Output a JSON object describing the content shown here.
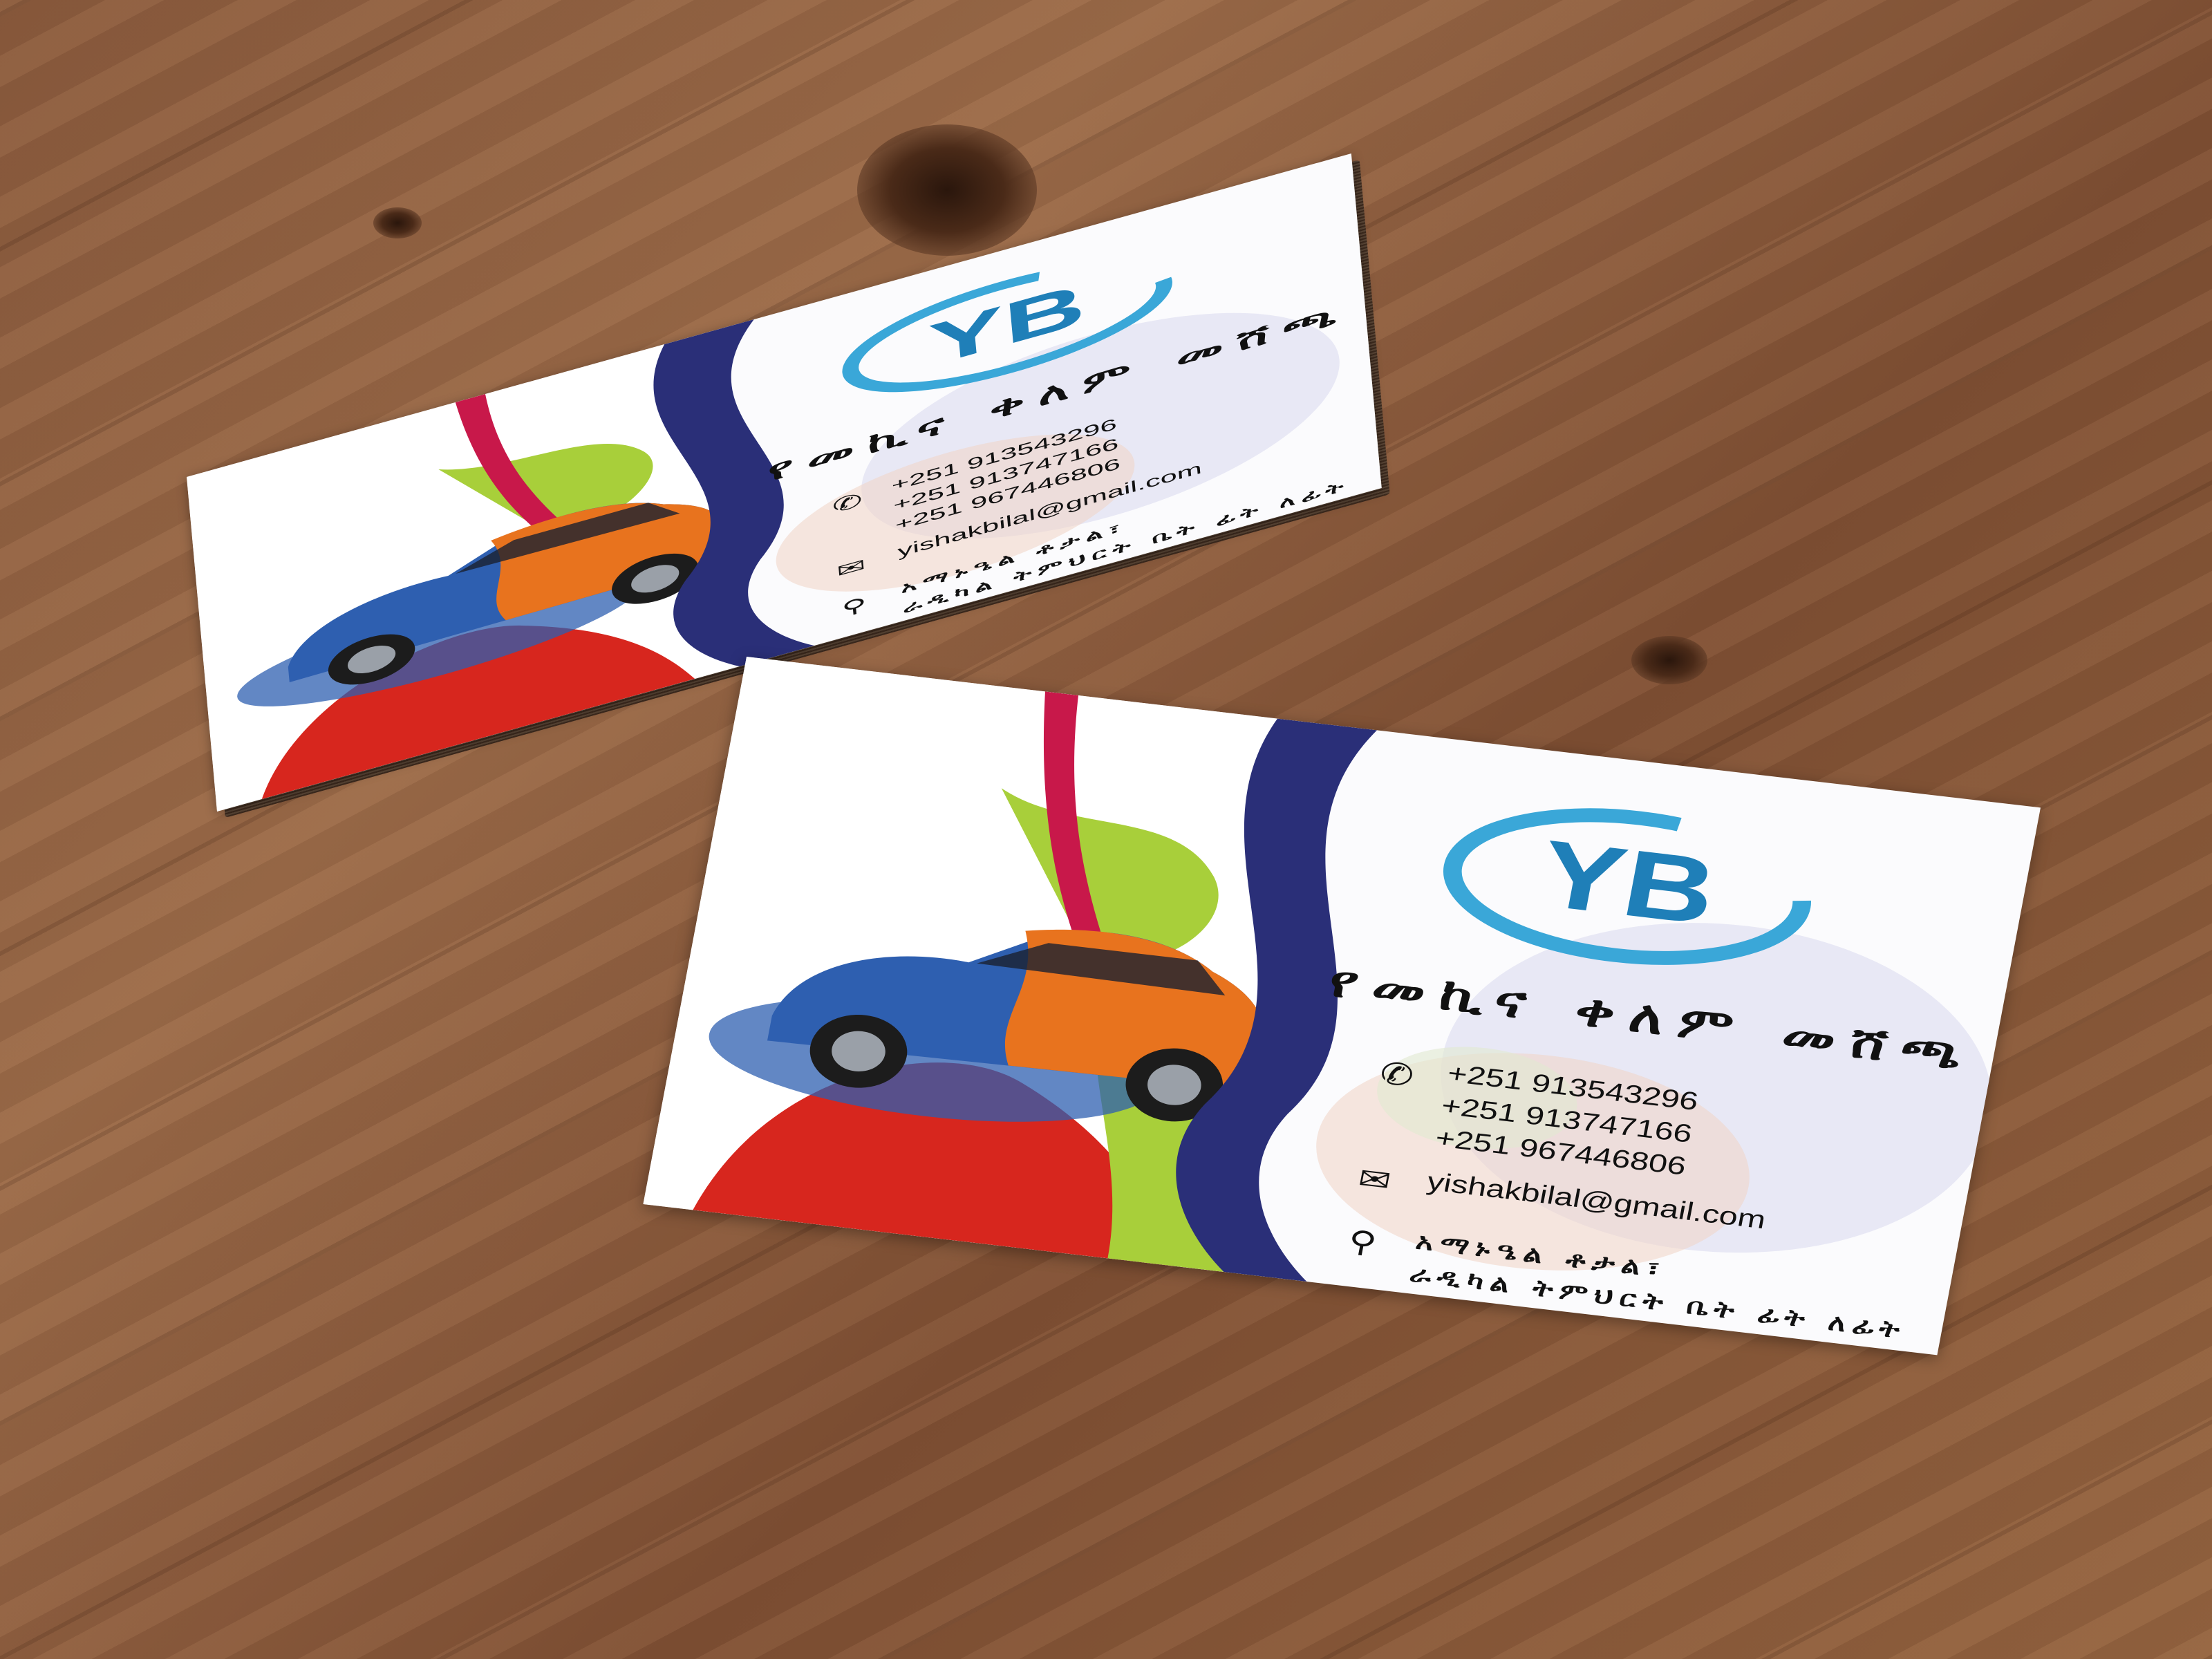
{
  "business": {
    "logo_text": "YB",
    "name": "የመኪና ቀለም መሸጫ",
    "phones": [
      "+251 913543296",
      "+251 913747166",
      "+251 967446806"
    ],
    "email": "yishakbilal@gmail.com",
    "address_line1": "አማኑዔል ቶታል፣",
    "address_line2": "ራዲካል ትምህርት ቤት ፊት ለፊት"
  },
  "colors": {
    "navy_band": "#2a2f78",
    "logo_blue": "#1f7fb8",
    "logo_ring": "#3aa7d8",
    "car_blue": "#2e5fb0",
    "car_orange": "#e8731e",
    "paint_red": "#d7261e",
    "paint_green": "#a8cf3a"
  },
  "icons": {
    "phone": "phone-icon",
    "mail": "envelope-icon",
    "location": "map-pin-icon"
  }
}
